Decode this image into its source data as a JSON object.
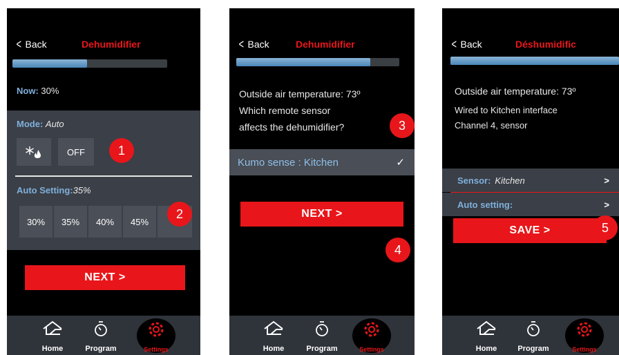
{
  "screens": [
    {
      "back": "Back",
      "title": "Dehumidifier",
      "progress": 0.48,
      "now_label": "Now:",
      "now_value": "30%",
      "mode_label": "Mode:",
      "mode_value": "Auto",
      "mode_icon": "snowflake-flame-icon",
      "off_label": "OFF",
      "auto_setting_label": "Auto Setting:",
      "auto_setting_value": "35%",
      "percent_options": [
        "30%",
        "35%",
        "40%",
        "45%",
        ""
      ],
      "next_label": "NEXT  >",
      "badges": [
        "1",
        "2"
      ]
    },
    {
      "back": "Back",
      "title": "Dehumidifier",
      "progress": 0.82,
      "outside_temp": "Outside air temperature:  73º",
      "question_line1": "Which remote sensor",
      "question_line2": "affects the dehumidifier?",
      "selected_sensor": "Kumo sense : Kitchen",
      "check": "✓",
      "next_label": "NEXT  >",
      "badges": [
        "3",
        "4"
      ]
    },
    {
      "back": "Back",
      "title": "Déshumidific",
      "progress": 1.0,
      "outside_temp": "Outside air temperature: 73º",
      "wired_line1": "Wired to Kitchen interface",
      "wired_line2": "Channel 4, sensor",
      "sensor_label": "Sensor:",
      "sensor_value": "Kitchen",
      "auto_setting_label": "Auto setting:",
      "chevron": ">",
      "save_label": "SAVE  >",
      "badges": [
        "5"
      ]
    }
  ],
  "nav": {
    "home": "Home",
    "program": "Program",
    "settings": "Settings"
  },
  "colors": {
    "accent": "#e8161a",
    "label_blue": "#7fb0dc",
    "panel": "#3b3f47"
  }
}
